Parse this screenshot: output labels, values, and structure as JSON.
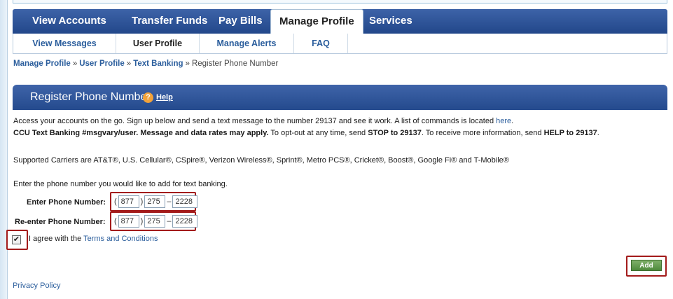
{
  "tabs": [
    {
      "label": "View Accounts"
    },
    {
      "label": "Transfer Funds"
    },
    {
      "label": "Pay Bills"
    },
    {
      "label": "Manage Profile"
    },
    {
      "label": "Services"
    }
  ],
  "subnav": [
    {
      "label": "View Messages"
    },
    {
      "label": "User Profile"
    },
    {
      "label": "Manage Alerts"
    },
    {
      "label": "FAQ"
    }
  ],
  "breadcrumb": {
    "items": [
      "Manage Profile",
      "User Profile",
      "Text Banking"
    ],
    "current": "Register Phone Number",
    "separator": "»"
  },
  "panel": {
    "title": "Register Phone Number",
    "help_icon": "?",
    "help_label": "Help"
  },
  "intro": {
    "line1": "Access your accounts on the go. Sign up below and send a text message to the number 29137 and see it work. A list of commands is located ",
    "line1_link": "here",
    "line1_end": ".",
    "line2_bold": "CCU Text Banking #msgvary/user. Message and data rates may apply.",
    "line2_a": " To opt-out at any time, send ",
    "line2_stop": "STOP to 29137",
    "line2_b": ". To receive more information, send ",
    "line2_help": "HELP to 29137",
    "line2_end": "."
  },
  "carriers": "Supported Carriers are AT&T®, U.S. Cellular®, CSpire®, Verizon Wireless®, Sprint®, Metro PCS®, Cricket®, Boost®, Google Fi® and T-Mobile®",
  "form": {
    "instruction": "Enter the phone number you would like to add for text banking.",
    "phone_label": "Enter Phone Number:",
    "reenter_label": "Re-enter Phone Number:",
    "phone": {
      "open": "(",
      "area": "877",
      "close": ")",
      "prefix": "275",
      "dash": "–",
      "line": "2228"
    },
    "reenter": {
      "open": "(",
      "area": "877",
      "close": ")",
      "prefix": "275",
      "dash": "–",
      "line": "2228"
    },
    "agree_checked": true,
    "check_glyph": "✔",
    "agree_text": "I agree with the ",
    "terms_link": "Terms and Conditions"
  },
  "add_label": "Add",
  "privacy_label": "Privacy Policy",
  "colors": {
    "nav": "#2d529a",
    "link": "#2a5d9c",
    "highlight": "#a31b1b",
    "add_button": "#5e9a4a"
  }
}
